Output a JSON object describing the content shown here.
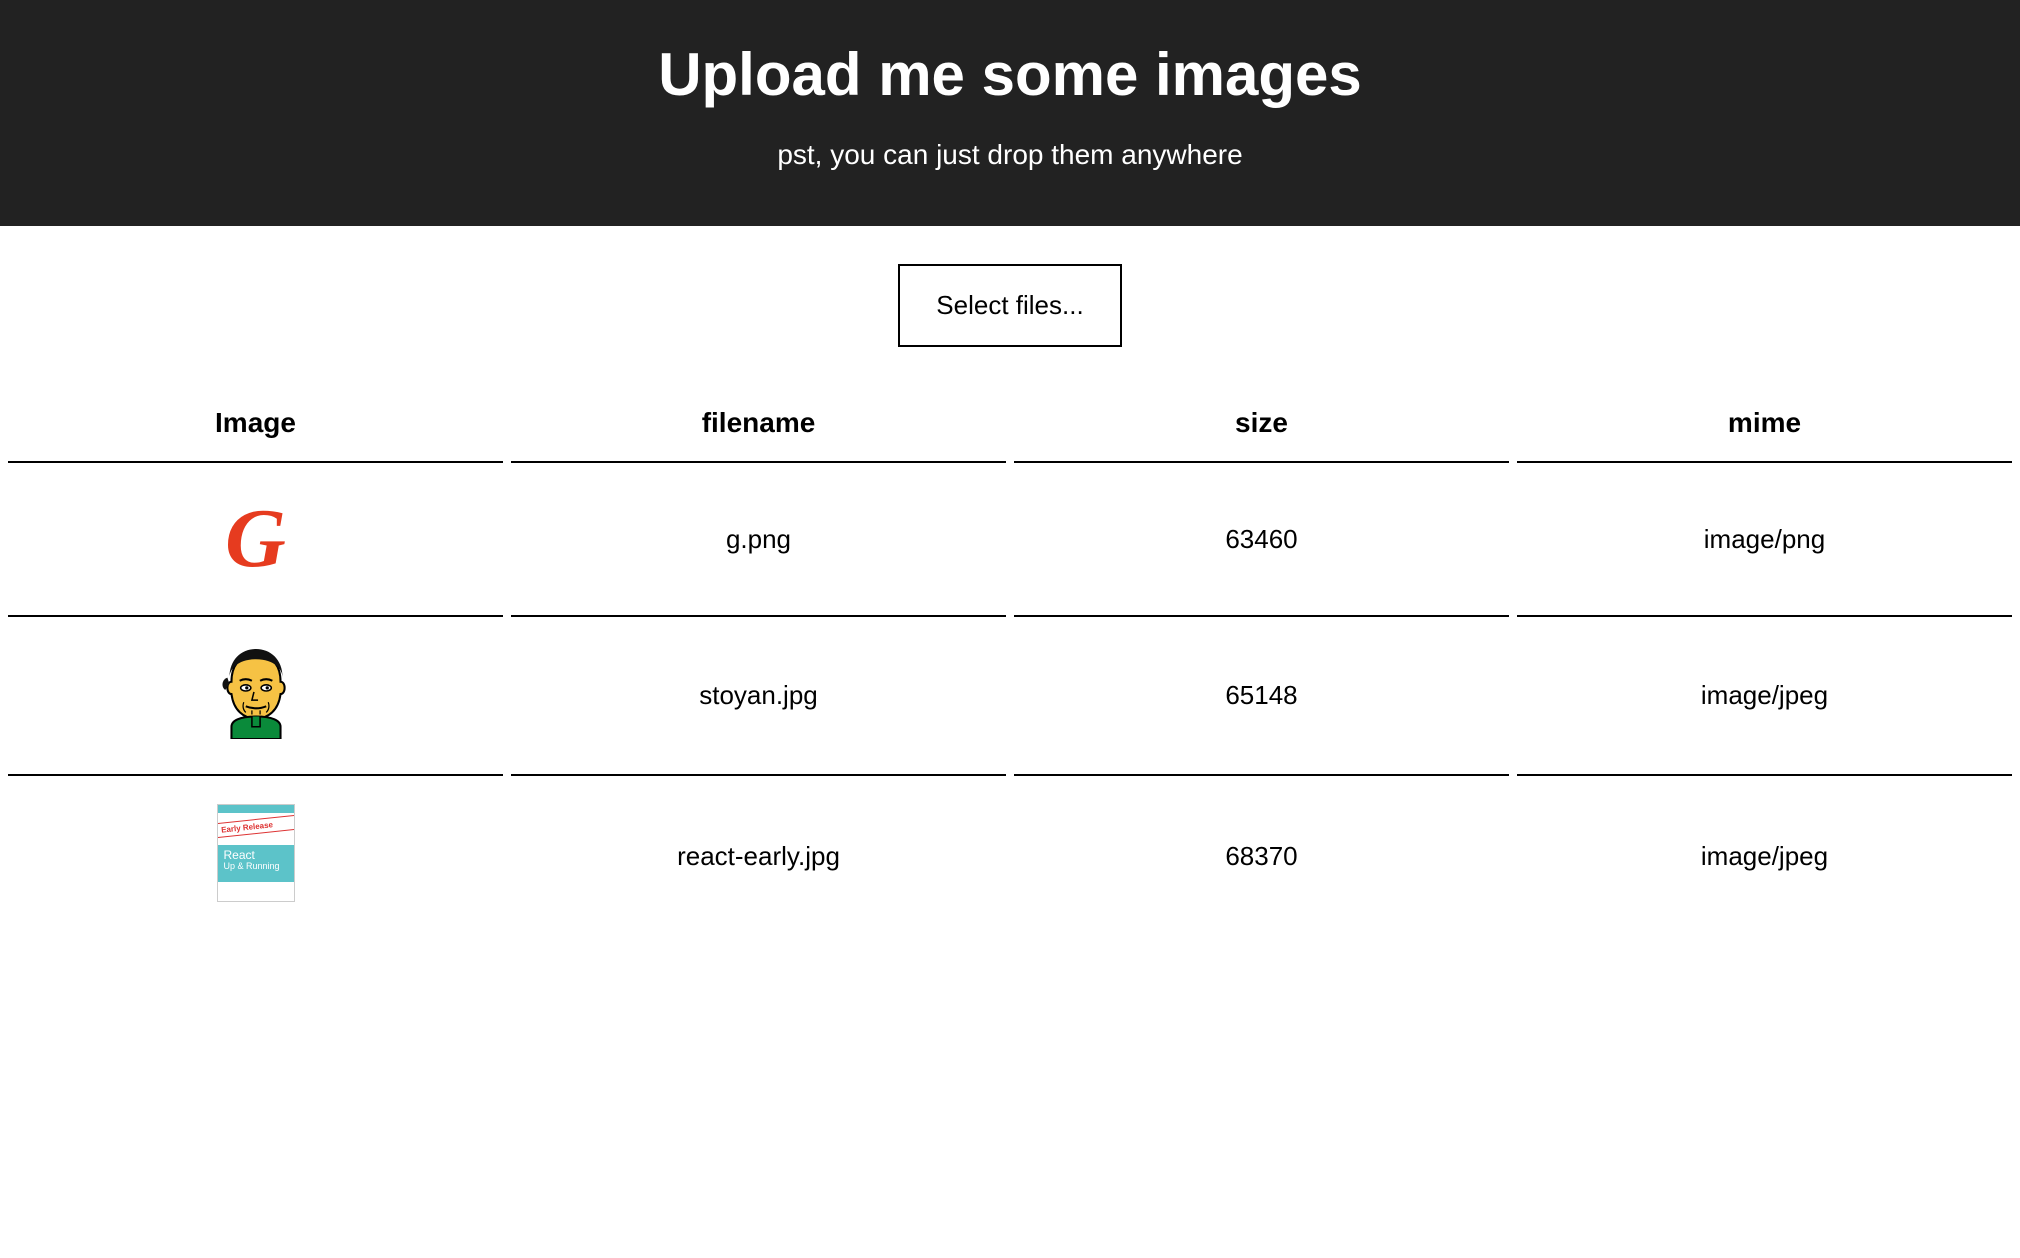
{
  "header": {
    "title": "Upload me some images",
    "subtitle": "pst, you can just drop them anywhere"
  },
  "controls": {
    "select_button_label": "Select files..."
  },
  "table": {
    "columns": [
      "Image",
      "filename",
      "size",
      "mime"
    ],
    "rows": [
      {
        "thumb_type": "g",
        "filename": "g.png",
        "size": "63460",
        "mime": "image/png"
      },
      {
        "thumb_type": "avatar",
        "filename": "stoyan.jpg",
        "size": "65148",
        "mime": "image/jpeg"
      },
      {
        "thumb_type": "book",
        "filename": "react-early.jpg",
        "size": "68370",
        "mime": "image/jpeg"
      }
    ]
  },
  "thumb_book": {
    "stamp": "Early Release",
    "title_line1": "React",
    "title_line2": "Up & Running"
  }
}
